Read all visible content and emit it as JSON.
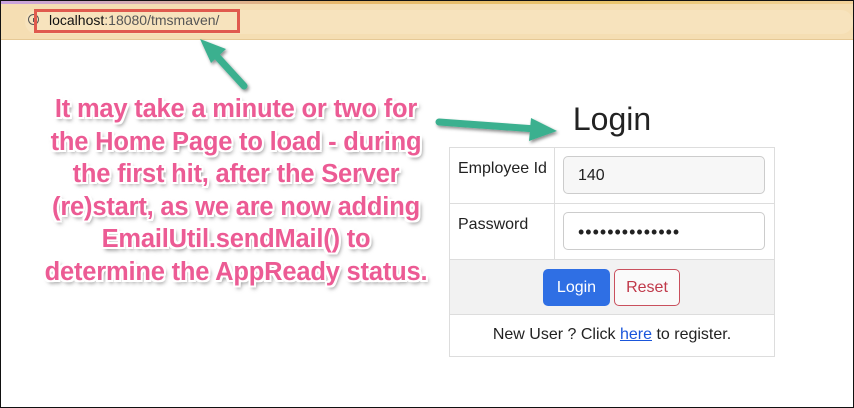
{
  "browser": {
    "url_host": "localhost",
    "url_rest": ":18080/tmsmaven/",
    "info_icon": "info-circle-icon"
  },
  "annotation": {
    "text": "It may take a minute or two for the Home Page to load - during the first hit, after the Server (re)start, as we are now adding EmailUtil.sendMail() to determine the AppReady status.",
    "color": "#ec5b94",
    "arrow_color": "#3bb08f"
  },
  "login": {
    "title": "Login",
    "employee_label": "Employee Id",
    "employee_value": "140",
    "password_label": "Password",
    "password_value": "••••••••••••••",
    "login_button": "Login",
    "reset_button": "Reset",
    "register_prefix": "New User ? Click ",
    "register_link": "here",
    "register_suffix": " to register."
  },
  "colors": {
    "url_highlight": "#e05a4e",
    "primary": "#2f6fe4",
    "danger": "#c0394a"
  }
}
